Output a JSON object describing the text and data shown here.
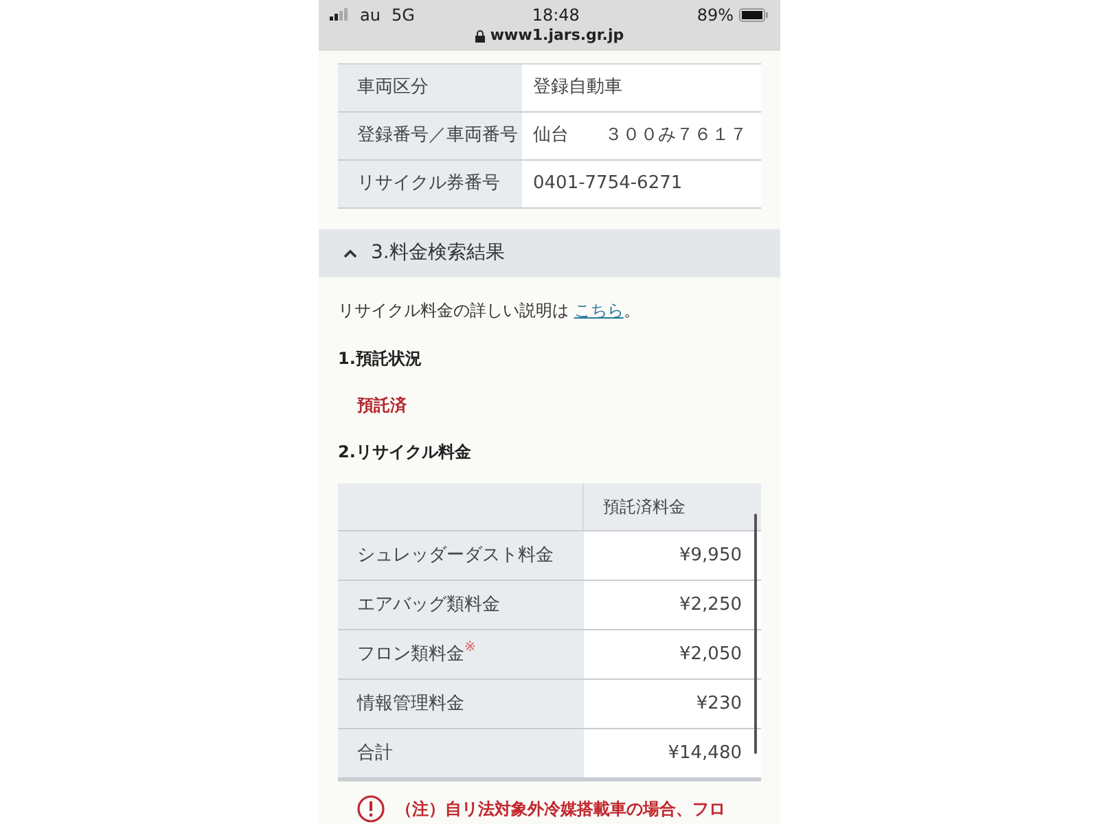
{
  "status_bar": {
    "carrier": "au",
    "network": "5G",
    "time": "18:48",
    "url": "www1.jars.gr.jp",
    "battery": "89%"
  },
  "vehicle_table": {
    "rows": [
      {
        "label": "車両区分",
        "value": "登録自動車"
      },
      {
        "label": "登録番号／車両番号",
        "value": "仙台　　３００み７６１７"
      },
      {
        "label": "リサイクル券番号",
        "value": "0401-7754-6271"
      }
    ]
  },
  "section": {
    "title": "3.料金検索結果",
    "expanded": true
  },
  "intro": {
    "text": "リサイクル料金の詳しい説明は ",
    "link": "こちら",
    "suffix": "。"
  },
  "deposit_heading": "1.預託状況",
  "deposit_status": "預託済",
  "fee_heading": "2.リサイクル料金",
  "fee_table": {
    "column_header": "預託済料金",
    "rows": [
      {
        "label": "シュレッダーダスト料金",
        "value": "¥9,950"
      },
      {
        "label": "エアバッグ類料金",
        "value": "¥2,250"
      },
      {
        "label": "フロン類料金",
        "mark": "※",
        "value": "¥2,050"
      },
      {
        "label": "情報管理料金",
        "value": "¥230"
      },
      {
        "label": "合計",
        "value": "¥14,480"
      }
    ]
  },
  "note": "（注）自リ法対象外冷媒搭載車の場合、フロ"
}
